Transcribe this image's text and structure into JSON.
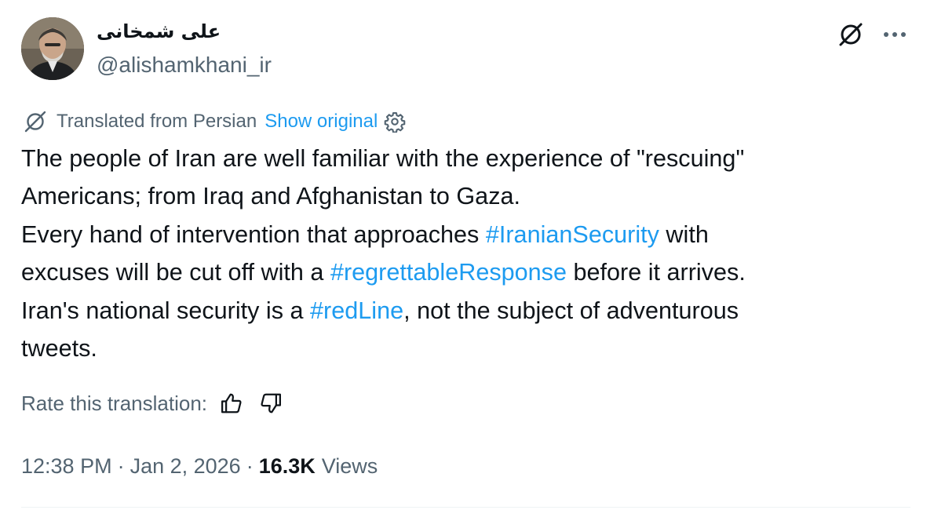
{
  "author": {
    "display_name": "علی شمخانی",
    "handle": "@alishamkhani_ir"
  },
  "translation": {
    "label": "Translated from Persian",
    "show_original": "Show original"
  },
  "tweet": {
    "lines": [
      {
        "parts": [
          {
            "text": "The people of Iran are well familiar with the experience of \"rescuing\""
          }
        ]
      },
      {
        "parts": [
          {
            "text": "Americans; from Iraq and Afghanistan to Gaza."
          }
        ]
      },
      {
        "parts": [
          {
            "text": "Every hand of intervention that approaches "
          },
          {
            "text": "#IranianSecurity",
            "hashtag": true
          },
          {
            "text": " with"
          }
        ]
      },
      {
        "parts": [
          {
            "text": "excuses will be cut off with a "
          },
          {
            "text": "#regrettableResponse",
            "hashtag": true
          },
          {
            "text": " before it arrives."
          }
        ]
      },
      {
        "parts": [
          {
            "text": "Iran's national security is a "
          },
          {
            "text": "#redLine",
            "hashtag": true
          },
          {
            "text": ", not the subject of adventurous"
          }
        ]
      },
      {
        "parts": [
          {
            "text": "tweets."
          }
        ]
      }
    ]
  },
  "rate": {
    "label": "Rate this translation:"
  },
  "meta": {
    "time": "12:38 PM",
    "date": "Jan 2, 2026",
    "separator": "·",
    "views_count": "16.3K",
    "views_label": "Views"
  },
  "icons": {
    "grok": "grok-icon",
    "more": "more-icon",
    "translate": "translate-icon",
    "settings": "gear-icon",
    "thumbs_up": "thumbs-up-icon",
    "thumbs_down": "thumbs-down-icon"
  },
  "colors": {
    "link": "#1d9bf0",
    "text": "#0f1419",
    "secondary": "#536471"
  }
}
